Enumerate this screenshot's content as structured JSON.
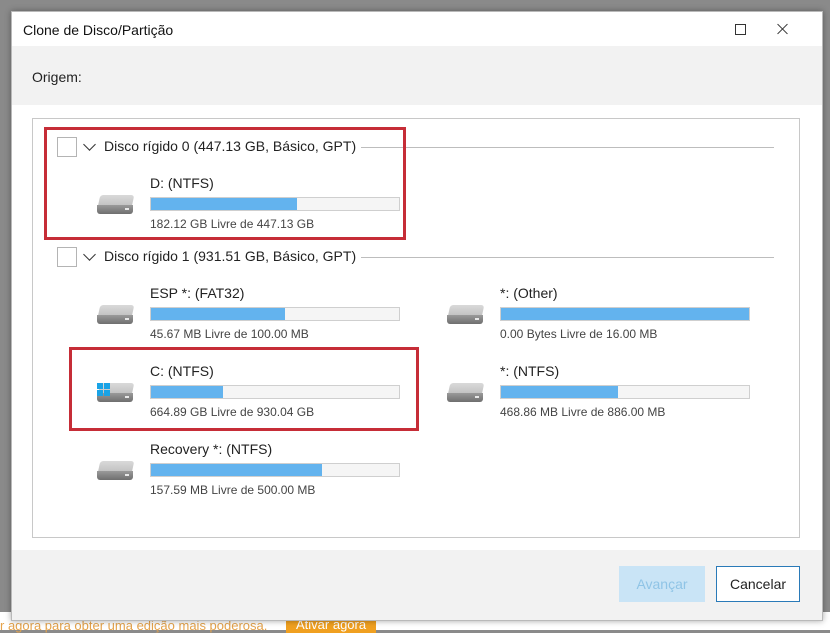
{
  "dialog": {
    "title": "Clone de Disco/Partição",
    "origin_label": "Origem:"
  },
  "disks": [
    {
      "label": "Disco rígido 0 (447.13 GB, Básico, GPT)",
      "partitions": [
        {
          "name": "D: (NTFS)",
          "free": "182.12 GB Livre de 447.13 GB",
          "used_fraction": 0.59,
          "icon": "drive-icon"
        }
      ]
    },
    {
      "label": "Disco rígido 1 (931.51 GB, Básico, GPT)",
      "partitions": [
        {
          "name": "ESP *: (FAT32)",
          "free": "45.67 MB Livre de 100.00 MB",
          "used_fraction": 0.54,
          "icon": "drive-icon"
        },
        {
          "name": "*: (Other)",
          "free": "0.00 Bytes Livre de 16.00 MB",
          "used_fraction": 1.0,
          "icon": "drive-icon"
        },
        {
          "name": "C: (NTFS)",
          "free": "664.89 GB Livre de 930.04 GB",
          "used_fraction": 0.29,
          "icon": "windows-drive-icon"
        },
        {
          "name": "*: (NTFS)",
          "free": "468.86 MB Livre de 886.00 MB",
          "used_fraction": 0.47,
          "icon": "drive-icon"
        },
        {
          "name": "Recovery *: (NTFS)",
          "free": "157.59 MB Livre de 500.00 MB",
          "used_fraction": 0.69,
          "icon": "drive-icon"
        }
      ]
    }
  ],
  "buttons": {
    "next": "Avançar",
    "cancel": "Cancelar"
  },
  "background": {
    "promo_text": "r agora para obter uma edição mais poderosa.",
    "activate_button": "Ativar agora"
  },
  "colors": {
    "bar_fill": "#63b3ee",
    "highlight": "#c62d37",
    "accent_border": "#2a7ab8"
  }
}
